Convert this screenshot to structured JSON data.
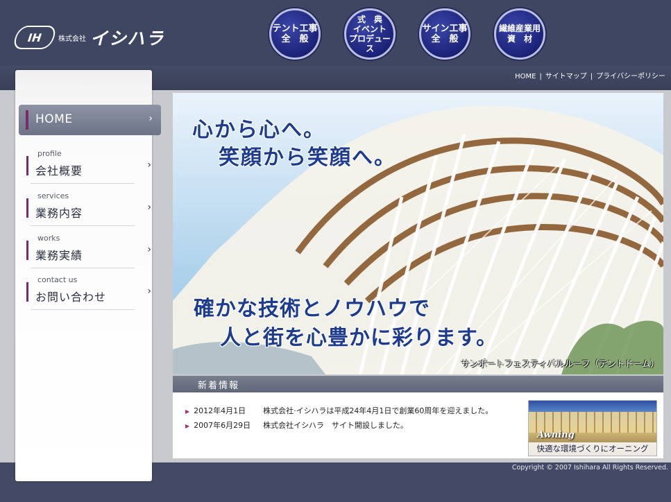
{
  "header": {
    "logo_mark": "IH",
    "logo_corp": "株式会社",
    "logo_name": "イシハラ",
    "categories": [
      {
        "label": "テント工事\n全　般"
      },
      {
        "label": "式　典\nイベント\nプロデュース"
      },
      {
        "label": "サイン工事\n全　般"
      },
      {
        "label": "繊維産業用\n資　材"
      }
    ],
    "top_links": [
      "HOME",
      "サイトマップ",
      "プライバシーポリシー"
    ],
    "top_link_sep": "|"
  },
  "sidebar": {
    "home": {
      "label": "HOME",
      "arrow": "›"
    },
    "items": [
      {
        "sub": "profile",
        "label": "会社概要",
        "arrow": "›"
      },
      {
        "sub": "services",
        "label": "業務内容",
        "arrow": "›"
      },
      {
        "sub": "works",
        "label": "業務実績",
        "arrow": "›"
      },
      {
        "sub": "contact us",
        "label": "お問い合わせ",
        "arrow": "›"
      }
    ]
  },
  "hero": {
    "line1": "心から心へ。",
    "line2": "笑顔から笑顔へ。",
    "line3": "確かな技術とノウハウで",
    "line4": "人と街を心豊かに彩ります。",
    "caption": "サンポートフェスティバルルーフ（テントドーム）"
  },
  "news": {
    "title": "新着情報",
    "items": [
      {
        "date": "2012年4月1日",
        "text": "株式会社·イシハラは平成24年4月1日で創業60周年を迎えました。"
      },
      {
        "date": "2007年6月29日",
        "text": "株式会社イシハラ　サイト開設しました。"
      }
    ],
    "bullet": "▶",
    "banner": {
      "title": "Awning",
      "caption": "快適な環境づくりにオーニング"
    }
  },
  "footer": {
    "copyright": "Copyright © 2007 Ishihara All Rights Reserved."
  },
  "colors": {
    "header_bg": "#3f4662",
    "accent": "#7a2a66",
    "hero_text": "#1d3c8e"
  }
}
